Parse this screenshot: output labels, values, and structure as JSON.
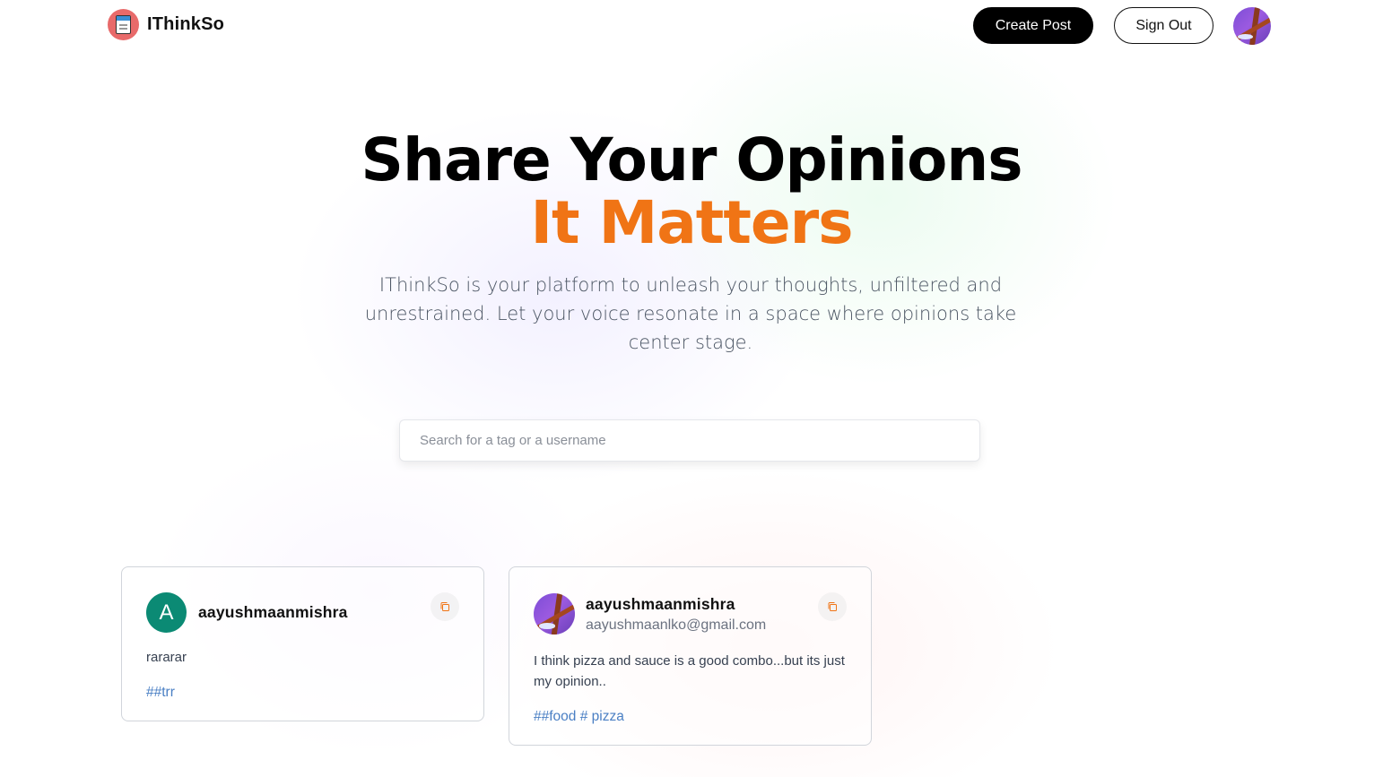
{
  "brand": {
    "name": "IThinkSo"
  },
  "nav": {
    "create_label": "Create Post",
    "signout_label": "Sign Out"
  },
  "hero": {
    "title": "Share Your Opinions",
    "highlight": "It Matters",
    "description": "IThinkSo is your platform to unleash your thoughts, unfiltered and unrestrained. Let your voice resonate in a space where opinions take center stage."
  },
  "search": {
    "placeholder": "Search for a tag or a username",
    "value": ""
  },
  "posts": [
    {
      "username": "aayushmaanmishra",
      "email": "",
      "avatar_letter": "A",
      "body": "rararar",
      "tags": "##trr"
    },
    {
      "username": "aayushmaanmishra",
      "email": "aayushmaanlko@gmail.com",
      "avatar_letter": "",
      "body": "I think pizza and sauce is a good combo...but its just my opinion..",
      "tags": "##food # pizza"
    }
  ],
  "colors": {
    "accent_orange": "#f07415",
    "primary_button": "#000000",
    "tag_blue": "#4a7fc4",
    "letter_avatar": "#0b8a74"
  }
}
